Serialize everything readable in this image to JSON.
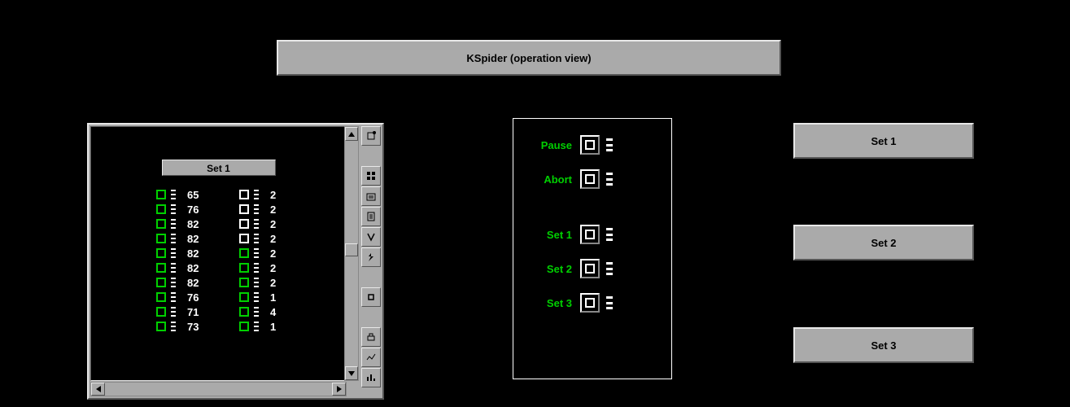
{
  "title": "KSpider (operation view)",
  "data_window": {
    "header": "Set 1",
    "rows": [
      {
        "left_sq": "green",
        "a": "65",
        "right_sq": "white",
        "b": "2"
      },
      {
        "left_sq": "green",
        "a": "76",
        "right_sq": "white",
        "b": "2"
      },
      {
        "left_sq": "green",
        "a": "82",
        "right_sq": "white",
        "b": "2"
      },
      {
        "left_sq": "green",
        "a": "82",
        "right_sq": "white",
        "b": "2"
      },
      {
        "left_sq": "green",
        "a": "82",
        "right_sq": "green",
        "b": "2"
      },
      {
        "left_sq": "green",
        "a": "82",
        "right_sq": "green",
        "b": "2"
      },
      {
        "left_sq": "green",
        "a": "82",
        "right_sq": "green",
        "b": "2"
      },
      {
        "left_sq": "green",
        "a": "76",
        "right_sq": "green",
        "b": "1"
      },
      {
        "left_sq": "green",
        "a": "71",
        "right_sq": "green",
        "b": "4"
      },
      {
        "left_sq": "green",
        "a": "73",
        "right_sq": "green",
        "b": "1"
      }
    ]
  },
  "toolbar_icons": [
    "tool-1",
    "tool-2",
    "tool-3",
    "tool-4",
    "tool-5",
    "tool-6",
    "tool-7",
    "tool-8",
    "tool-9",
    "tool-10",
    "tool-11",
    "tool-12"
  ],
  "control_panel": {
    "top": [
      {
        "label": "Pause"
      },
      {
        "label": "Abort"
      }
    ],
    "sets": [
      {
        "label": "Set 1"
      },
      {
        "label": "Set 2"
      },
      {
        "label": "Set 3"
      }
    ]
  },
  "big_buttons": {
    "set1": "Set 1",
    "set2": "Set 2",
    "set3": "Set 3"
  }
}
